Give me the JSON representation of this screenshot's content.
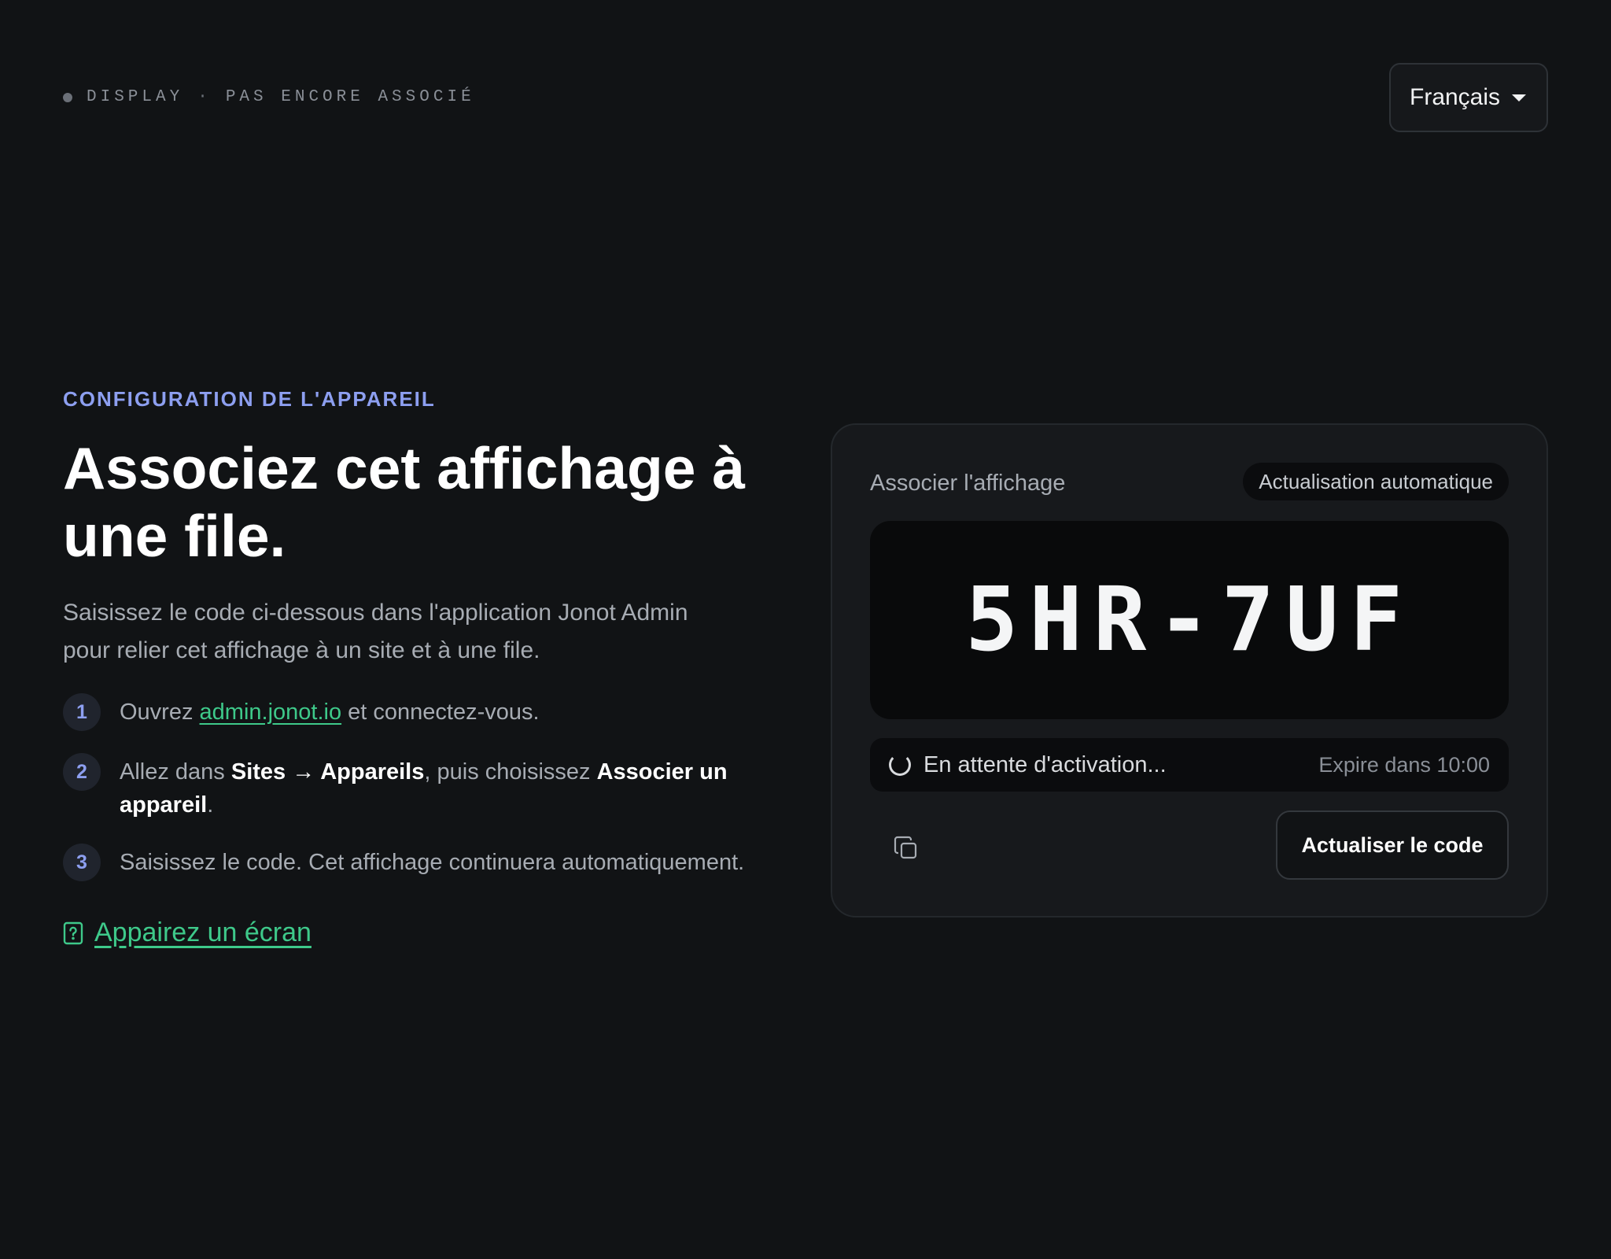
{
  "status": {
    "device": "DISPLAY",
    "separator": "·",
    "state": "PAS ENCORE ASSOCIÉ"
  },
  "language": {
    "selected": "Français"
  },
  "intro": {
    "eyebrow": "CONFIGURATION DE L'APPAREIL",
    "headline": "Associez cet affichage à une file.",
    "lead": "Saisissez le code ci-dessous dans l'application Jonot Admin pour relier cet affichage à un site et à une file."
  },
  "steps": [
    {
      "number": "1",
      "text_before": "Ouvrez ",
      "link": "admin.jonot.io",
      "text_after": " et connectez-vous."
    },
    {
      "number": "2",
      "text_before": "Allez dans ",
      "bold_1": "Sites → Appareils",
      "text_middle": ", puis choisissez ",
      "bold_2": "Associer un appareil",
      "text_after": "."
    },
    {
      "number": "3",
      "text": "Saisissez le code. Cet affichage continuera automatiquement."
    }
  ],
  "help_link": "Appairez un écran",
  "card": {
    "title": "Associer l'affichage",
    "badge": "Actualisation automatique",
    "code": "5HR-7UF",
    "waiting": "En attente d'activation...",
    "expires": "Expire dans 10:00",
    "refresh_label": "Actualiser le code"
  },
  "colors": {
    "background": "#111315",
    "accent_blue": "#8d9ff0",
    "accent_green": "#3ec98a"
  },
  "icons": {
    "help": "help-document-icon",
    "spinner": "loading-spinner-icon",
    "copy": "copy-icon",
    "caret": "chevron-down-icon"
  }
}
